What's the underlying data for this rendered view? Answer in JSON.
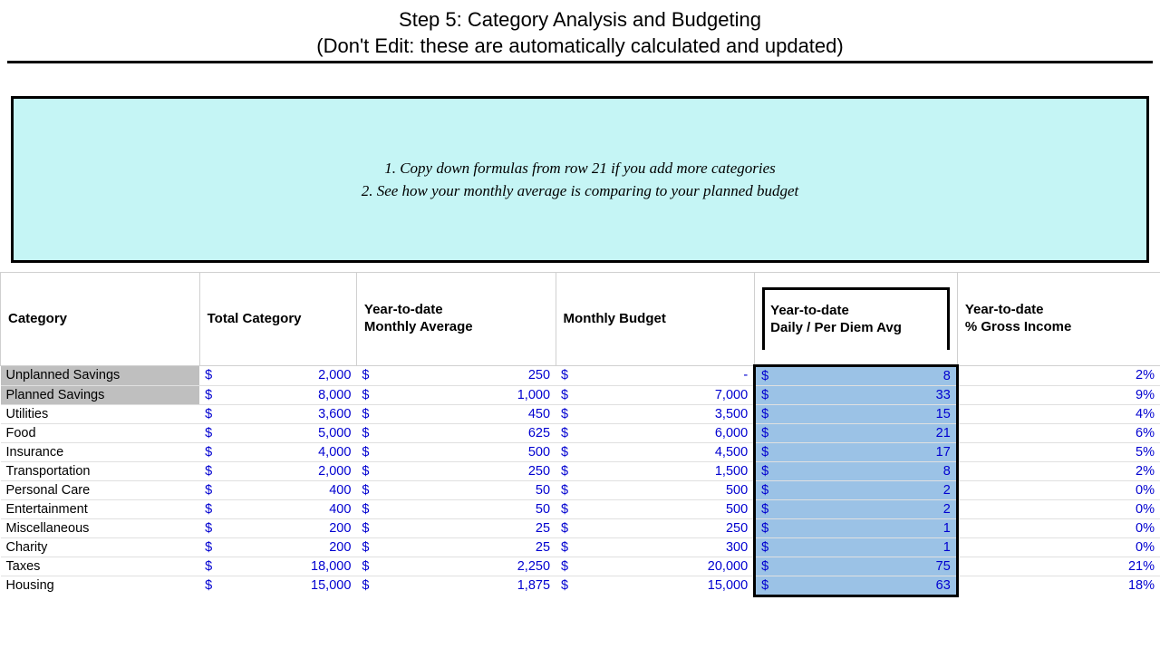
{
  "title_line1": "Step 5: Category Analysis and Budgeting",
  "title_line2": "(Don't Edit: these are automatically calculated and updated)",
  "info_lines": [
    "1. Copy down formulas from row 21 if you add more categories",
    "2. See how your monthly average is comparing to your planned budget"
  ],
  "headers": {
    "category": "Category",
    "total": "Total Category",
    "ytd_avg": "Year-to-date\nMonthly Average",
    "budget": "Monthly Budget",
    "daily": "Year-to-date\nDaily / Per Diem Avg",
    "pct": "Year-to-date\n% Gross Income"
  },
  "rows": [
    {
      "cat": "Unplanned Savings",
      "grey": true,
      "total": "2,000",
      "ytd": "250",
      "budget": "-",
      "daily": "8",
      "pct": "2%"
    },
    {
      "cat": "Planned Savings",
      "grey": true,
      "total": "8,000",
      "ytd": "1,000",
      "budget": "7,000",
      "daily": "33",
      "pct": "9%"
    },
    {
      "cat": "Utilities",
      "total": "3,600",
      "ytd": "450",
      "budget": "3,500",
      "daily": "15",
      "pct": "4%"
    },
    {
      "cat": "Food",
      "total": "5,000",
      "ytd": "625",
      "budget": "6,000",
      "daily": "21",
      "pct": "6%"
    },
    {
      "cat": "Insurance",
      "total": "4,000",
      "ytd": "500",
      "budget": "4,500",
      "daily": "17",
      "pct": "5%"
    },
    {
      "cat": "Transportation",
      "total": "2,000",
      "ytd": "250",
      "budget": "1,500",
      "daily": "8",
      "pct": "2%"
    },
    {
      "cat": "Personal Care",
      "total": "400",
      "ytd": "50",
      "budget": "500",
      "daily": "2",
      "pct": "0%"
    },
    {
      "cat": "Entertainment",
      "total": "400",
      "ytd": "50",
      "budget": "500",
      "daily": "2",
      "pct": "0%"
    },
    {
      "cat": "Miscellaneous",
      "total": "200",
      "ytd": "25",
      "budget": "250",
      "daily": "1",
      "pct": "0%"
    },
    {
      "cat": "Charity",
      "total": "200",
      "ytd": "25",
      "budget": "300",
      "daily": "1",
      "pct": "0%"
    },
    {
      "cat": "Taxes",
      "total": "18,000",
      "ytd": "2,250",
      "budget": "20,000",
      "daily": "75",
      "pct": "21%"
    },
    {
      "cat": "Housing",
      "total": "15,000",
      "ytd": "1,875",
      "budget": "15,000",
      "daily": "63",
      "pct": "18%"
    }
  ]
}
